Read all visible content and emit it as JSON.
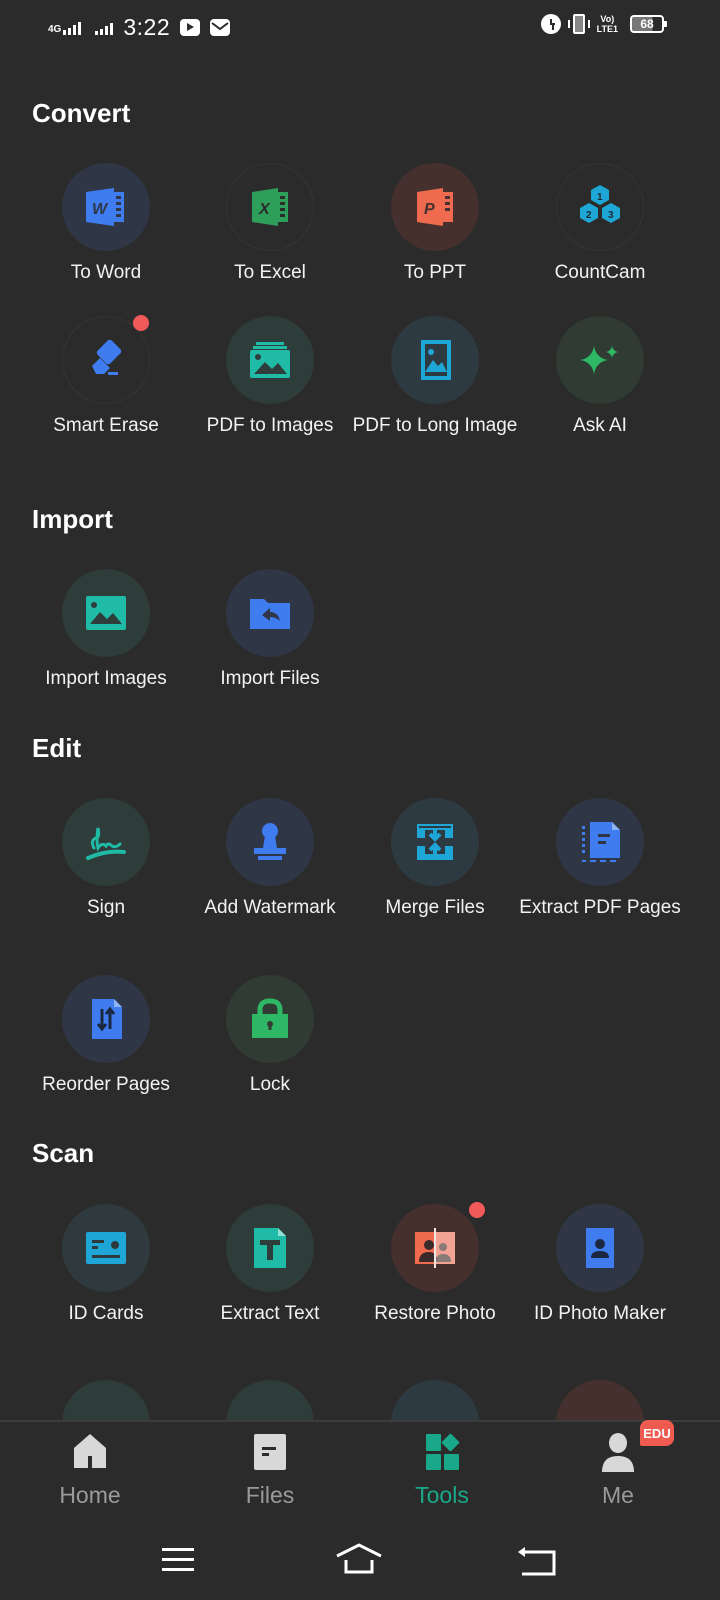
{
  "status_bar": {
    "network": "4G",
    "time": "3:22",
    "volte": "Vo LTE1",
    "battery": "68",
    "battery_level_percent": 68,
    "icons": [
      "signal-4g-icon",
      "signal-icon",
      "youtube-icon",
      "mail-icon",
      "alarm-icon",
      "vibrate-icon",
      "volte-icon",
      "battery-icon"
    ]
  },
  "sections": [
    {
      "title": "Convert",
      "tools": [
        {
          "label": "To Word",
          "icon": "word-icon",
          "color": "#3f7cf0",
          "badge": false
        },
        {
          "label": "To Excel",
          "icon": "excel-icon",
          "color": "#2e9e5b",
          "badge": false
        },
        {
          "label": "To PPT",
          "icon": "ppt-icon",
          "color": "#ef6a4f",
          "badge": false
        },
        {
          "label": "CountCam",
          "icon": "countcam-icon",
          "color": "#1ea7d6",
          "badge": false
        },
        {
          "label": "Smart Erase",
          "icon": "eraser-icon",
          "color": "#3f7cf0",
          "badge": true
        },
        {
          "label": "PDF to Images",
          "icon": "images-stack-icon",
          "color": "#1fbba6",
          "badge": false
        },
        {
          "label": "PDF to Long Image",
          "icon": "long-image-icon",
          "color": "#1ea7d6",
          "badge": false
        },
        {
          "label": "Ask AI",
          "icon": "sparkle-icon",
          "color": "#2eb865",
          "badge": false
        }
      ]
    },
    {
      "title": "Import",
      "tools": [
        {
          "label": "Import Images",
          "icon": "image-icon",
          "color": "#1fbba6",
          "badge": false
        },
        {
          "label": "Import Files",
          "icon": "folder-import-icon",
          "color": "#3f7cf0",
          "badge": false
        }
      ]
    },
    {
      "title": "Edit",
      "tools": [
        {
          "label": "Sign",
          "icon": "signature-icon",
          "color": "#1fbba6",
          "badge": false
        },
        {
          "label": "Add Watermark",
          "icon": "stamp-icon",
          "color": "#3f7cf0",
          "badge": false
        },
        {
          "label": "Merge Files",
          "icon": "merge-icon",
          "color": "#1ea7d6",
          "badge": false
        },
        {
          "label": "Extract PDF Pages",
          "icon": "extract-pages-icon",
          "color": "#3f7cf0",
          "badge": false
        },
        {
          "label": "Reorder Pages",
          "icon": "reorder-icon",
          "color": "#3f7cf0",
          "badge": false
        },
        {
          "label": "Lock",
          "icon": "lock-icon",
          "color": "#2eb865",
          "badge": false
        }
      ]
    },
    {
      "title": "Scan",
      "tools": [
        {
          "label": "ID Cards",
          "icon": "id-card-icon",
          "color": "#1ea7d6",
          "badge": false
        },
        {
          "label": "Extract Text",
          "icon": "text-doc-icon",
          "color": "#1fbba6",
          "badge": false
        },
        {
          "label": "Restore Photo",
          "icon": "restore-photo-icon",
          "color": "#ef6a4f",
          "badge": true
        },
        {
          "label": "ID Photo Maker",
          "icon": "id-photo-icon",
          "color": "#3f7cf0",
          "badge": false
        }
      ]
    }
  ],
  "bottom_nav": {
    "items": [
      {
        "label": "Home",
        "icon": "home-icon",
        "active": false
      },
      {
        "label": "Files",
        "icon": "files-icon",
        "active": false
      },
      {
        "label": "Tools",
        "icon": "tools-icon",
        "active": true
      },
      {
        "label": "Me",
        "icon": "person-icon",
        "active": false
      }
    ],
    "me_badge": "EDU",
    "active_color": "#19a98a",
    "inactive_color": "#9a9a9a"
  },
  "system_nav": {
    "buttons": [
      "menu-icon",
      "home-icon",
      "back-icon"
    ]
  }
}
